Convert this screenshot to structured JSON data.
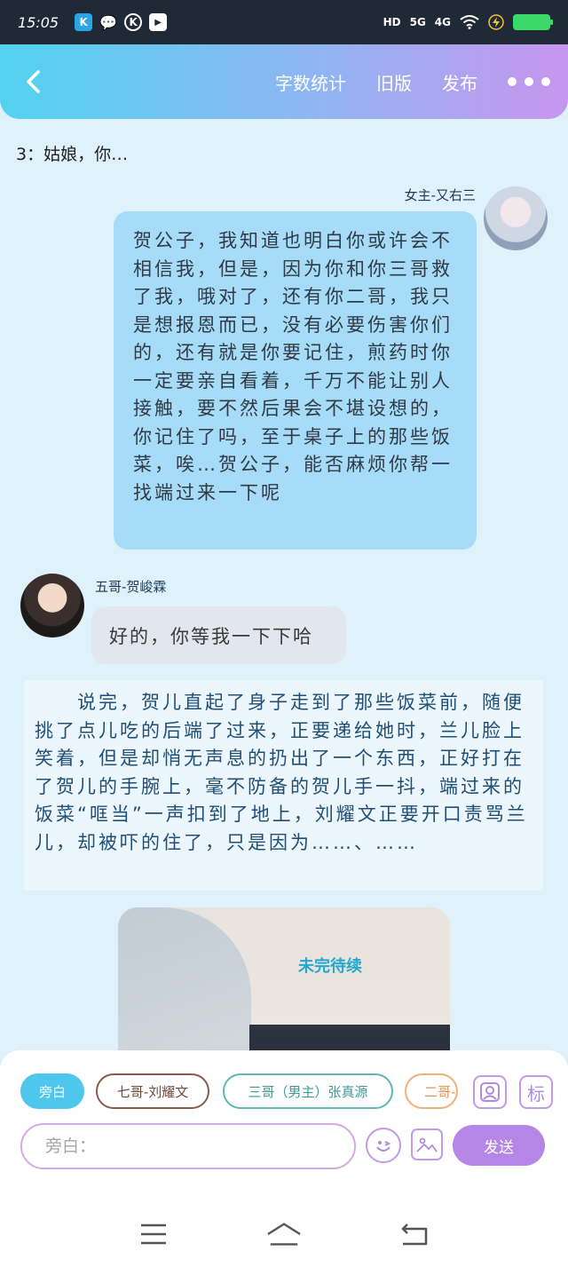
{
  "status_bar": {
    "time": "15:05",
    "app_icons": [
      "K",
      "wechat",
      "K",
      "video"
    ],
    "network": [
      "HD",
      "5G",
      "4G"
    ],
    "battery_level": 0.9
  },
  "header": {
    "actions": [
      "字数统计",
      "旧版",
      "发布"
    ]
  },
  "chat": {
    "plain_line": "3：姑娘，你…",
    "messages": [
      {
        "side": "right",
        "speaker": "女主-又右三",
        "text": "贺公子，我知道也明白你或许会不相信我，但是，因为你和你三哥救了我，哦对了，还有你二哥，我只是想报恩而已，没有必要伤害你们的，还有就是你要记住，煎药时你一定要亲自看着，千万不能让别人接触，要不然后果会不堪设想的，你记住了吗，至于桌子上的那些饭菜，唉…贺公子，能否麻烦你帮一找端过来一下呢"
      },
      {
        "side": "left",
        "speaker": "五哥-贺峻霖",
        "text": "好的，你等我一下下哈"
      }
    ],
    "narration": "　　说完，贺儿直起了身子走到了那些饭菜前，随便挑了点儿吃的后端了过来，正要递给她时，兰儿脸上笑着，但是却悄无声息的扔出了一个东西，正好打在了贺儿的手腕上，毫不防备的贺儿手一抖，端过来的饭菜“哐当”一声扣到了地上，刘耀文正要开口责骂兰儿，却被吓的住了，只是因为……、……",
    "image_caption": "未完待续"
  },
  "input_panel": {
    "roles": [
      "旁白",
      "七哥-刘耀文",
      "三哥（男主）张真源",
      "二哥-"
    ],
    "tag_label": "标",
    "input_placeholder": "旁白：",
    "send_label": "发送"
  },
  "colors": {
    "header_start": "#52d3f0",
    "header_end": "#c796ee",
    "bubble_right": "#a6dcf7",
    "send_button": "#b586e5"
  }
}
